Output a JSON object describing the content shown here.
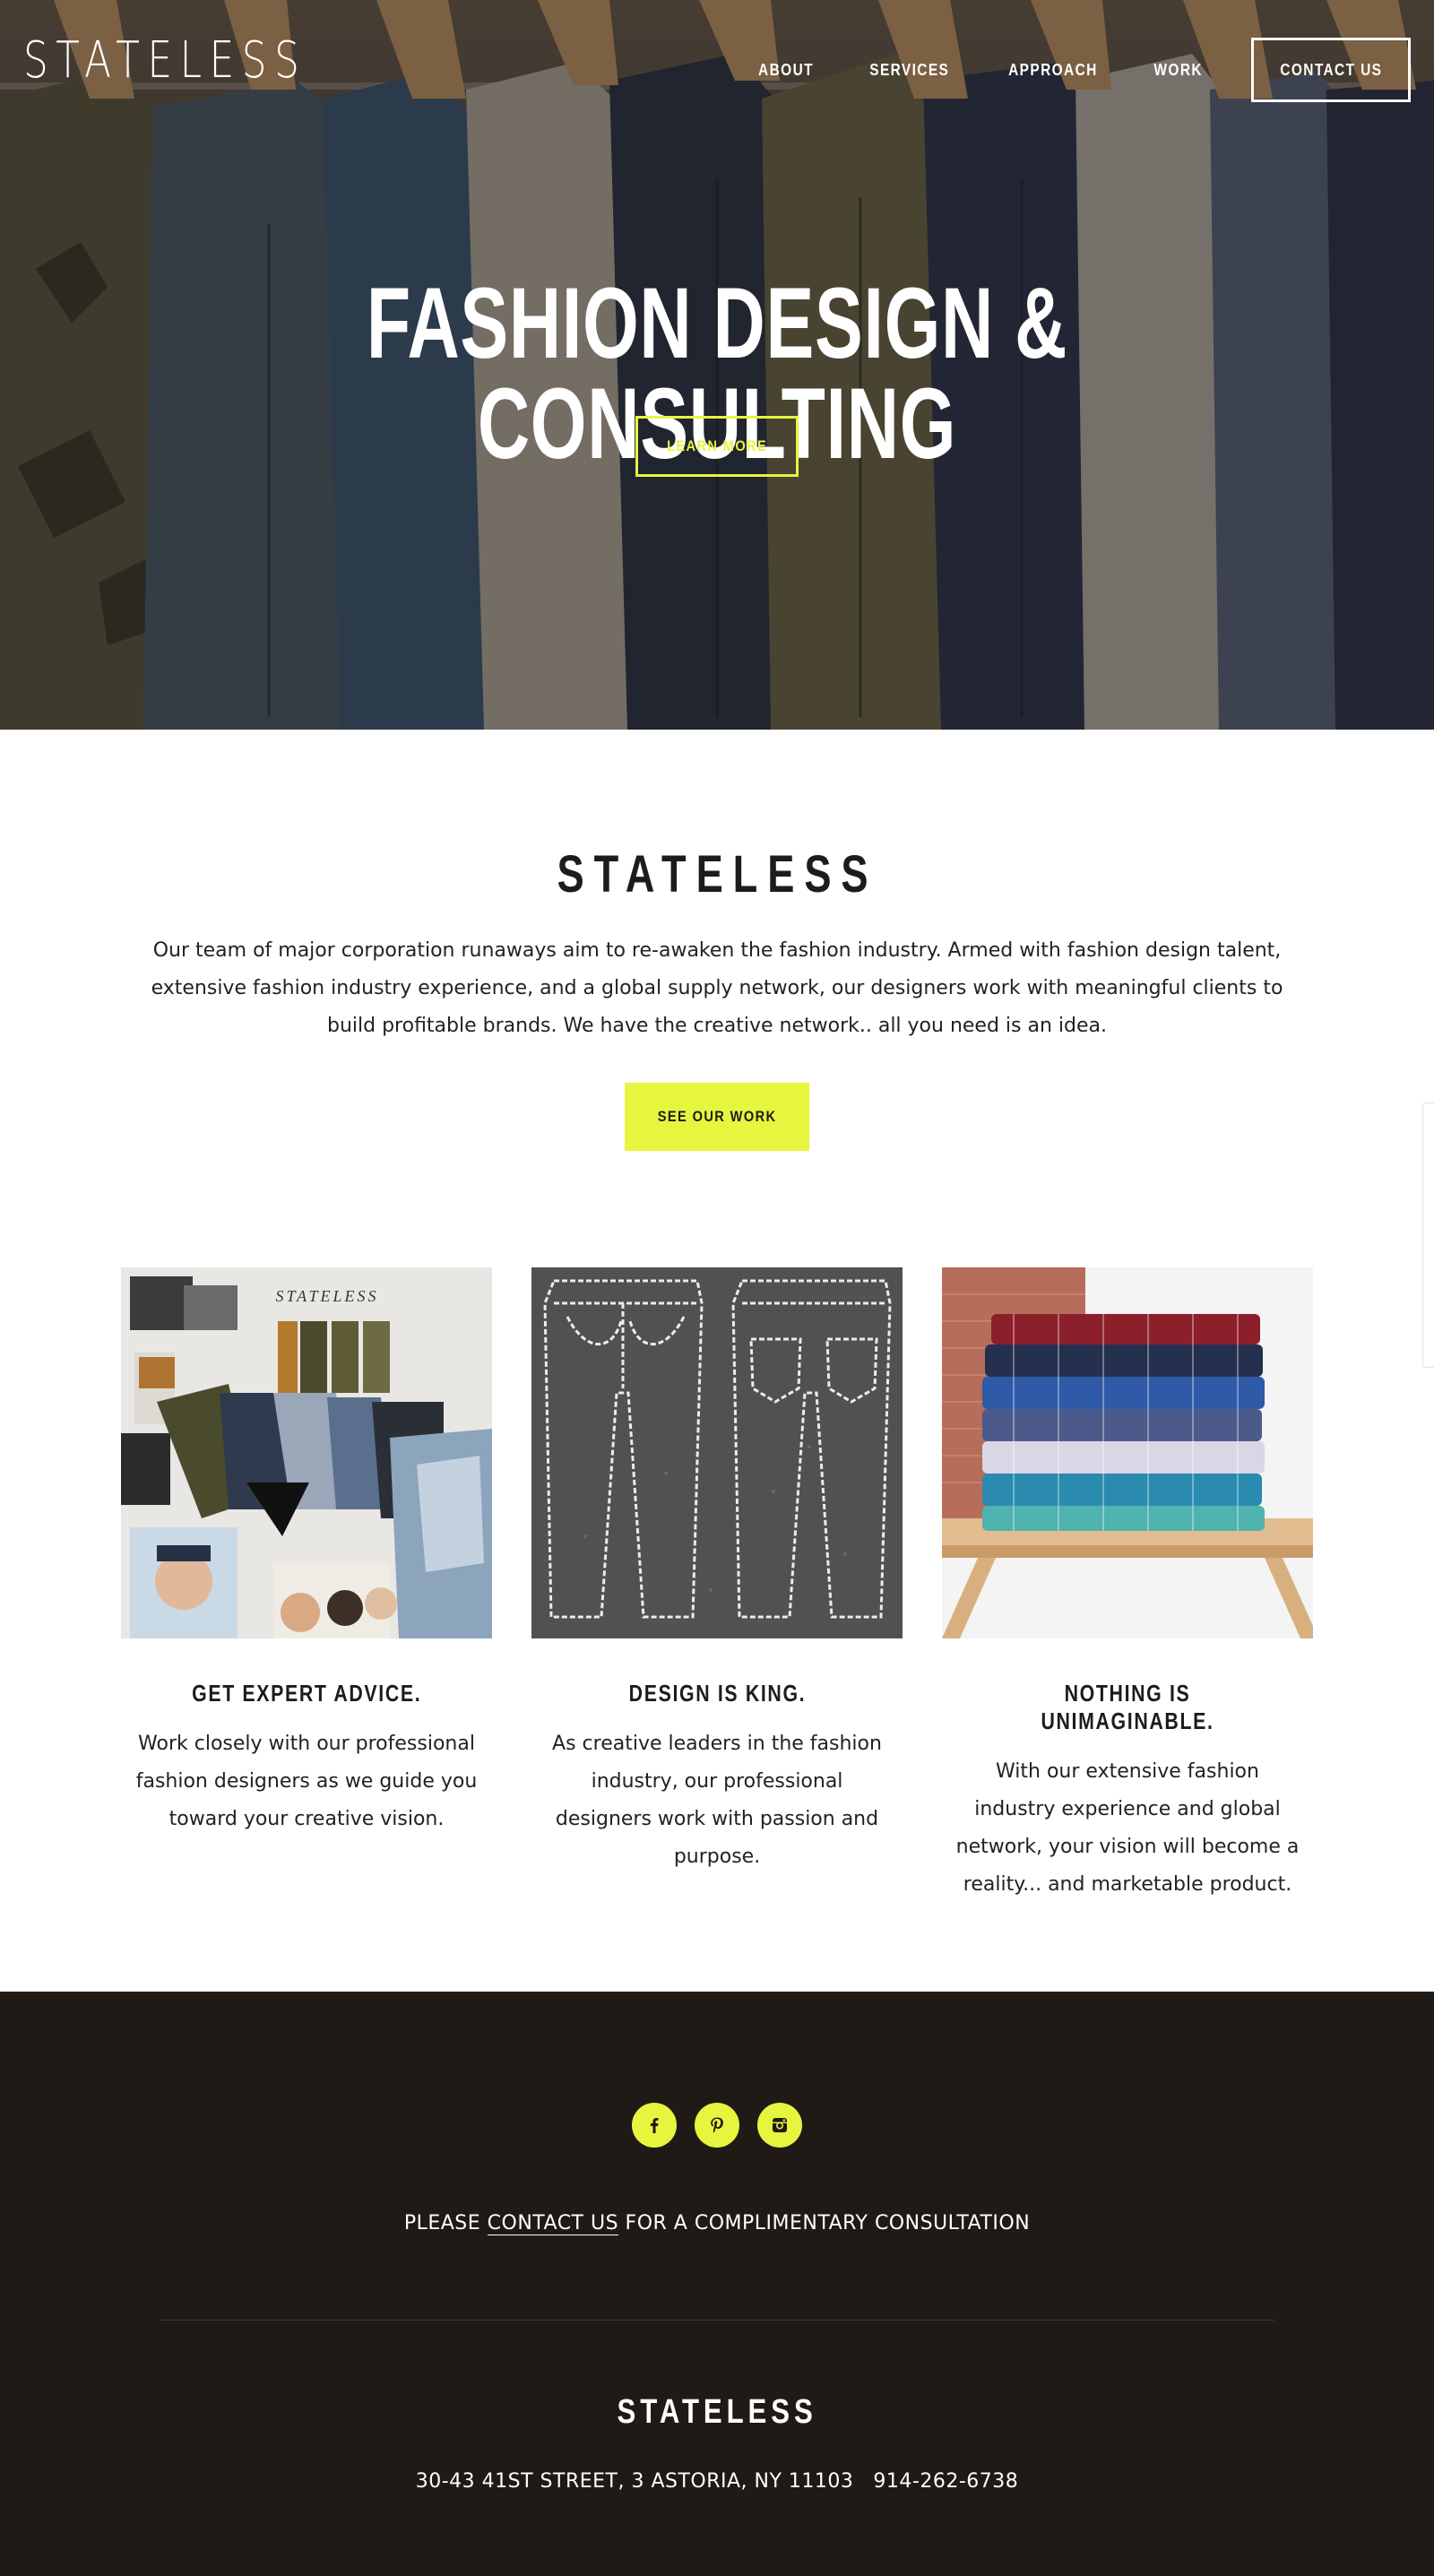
{
  "header": {
    "brand": "STATELESS",
    "nav": [
      "ABOUT",
      "SERVICES",
      "APPROACH",
      "WORK"
    ],
    "contact_label": "CONTACT US"
  },
  "hero": {
    "title": "FASHION DESIGN & CONSULTING",
    "button_label": "LEARN MORE"
  },
  "intro": {
    "heading": "STATELESS",
    "text": "Our team of major corporation runaways aim to re-awaken the fashion industry. Armed with fashion design talent, extensive fashion industry experience, and a global supply network, our designers work with meaningful clients to build profitable brands. We have the creative network.. all you need is an idea.",
    "button_label": "SEE OUR WORK"
  },
  "features": [
    {
      "image": "mood-board-photo",
      "image_text": "STATELESS",
      "title": "GET EXPERT ADVICE.",
      "text": "Work closely with our professional fashion designers as we guide you toward your creative vision."
    },
    {
      "image": "jeans-sketch-photo",
      "title": "DESIGN IS KING.",
      "text": "As creative leaders in the fashion industry, our professional designers work with passion and purpose."
    },
    {
      "image": "folded-shirts-photo",
      "title": "NOTHING IS UNIMAGINABLE.",
      "text": "With our extensive fashion industry experience and global network, your vision will become a reality... and marketable product."
    }
  ],
  "footer": {
    "social": [
      "facebook-icon",
      "pinterest-icon",
      "instagram-icon"
    ],
    "cta_before": "PLEASE ",
    "cta_link": "CONTACT US",
    "cta_after": " FOR A COMPLIMENTARY CONSULTATION",
    "brand": "STATELESS",
    "address": "30-43 41ST STREET, 3 ASTORIA, NY 11103",
    "phone": "914-262-6738"
  },
  "colors": {
    "accent": "#e6f53d",
    "footer_bg": "#201a17",
    "text": "#1c1c1c"
  }
}
